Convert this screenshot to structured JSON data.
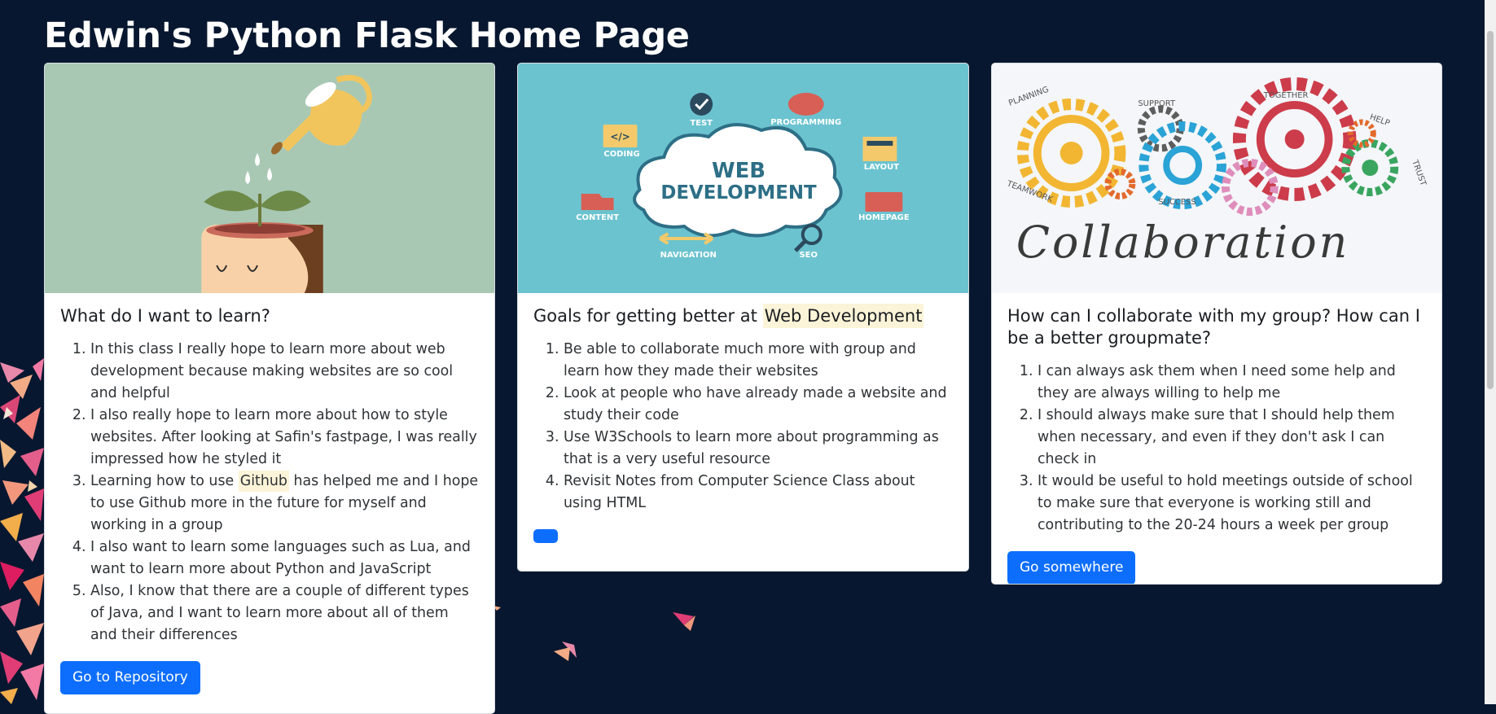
{
  "header": {
    "title": "Edwin's Python Flask Home Page"
  },
  "cards": [
    {
      "title": "What do I want to learn?",
      "items": [
        "In this class I really hope to learn more about web development because making websites are so cool and helpful",
        "I also really hope to learn more about how to style websites. After looking at Safin's fastpage, I was really impressed how he styled it",
        {
          "before": "Learning how to use ",
          "highlight": "Github",
          "after": " has helped me and I hope to use Github more in the future for myself and working in a group"
        },
        "I also want to learn some languages such as Lua, and want to learn more about Python and JavaScript",
        "Also, I know that there are a couple of different types of Java, and I want to learn more about all of them and their differences"
      ],
      "button": "Go to Repository"
    },
    {
      "title_prefix": "Goals for getting better at ",
      "title_highlight": "Web Development",
      "items": [
        "Be able to collaborate much more with group and learn how they made their websites",
        "Look at people who have already made a website and study their code",
        "Use W3Schools to learn more about programming as that is a very useful resource",
        "Revisit Notes from Computer Science Class about using HTML"
      ],
      "button": ""
    },
    {
      "title": "How can I collaborate with my group? How can I be a better groupmate?",
      "items": [
        "I can always ask them when I need some help and they are always willing to help me",
        "I should always make sure that I should help them when necessary, and even if they don't ask I can check in",
        "It would be useful to hold meetings outside of school to make sure that everyone is working still and contributing to the 20-24 hours a week per group"
      ],
      "button": "Go somewhere"
    }
  ],
  "images": {
    "web_dev": {
      "title_line1": "WEB",
      "title_line2": "DEVELOPMENT",
      "labels": [
        "TEST",
        "PROGRAMMING",
        "CODING",
        "LAYOUT",
        "CONTENT",
        "HOMEPAGE",
        "NAVIGATION",
        "SEO"
      ],
      "code_tag": "</>"
    },
    "collab": {
      "word": "Collaboration",
      "labels": [
        "PLANNING",
        "SUPPORT",
        "TOGETHER",
        "HELP",
        "TRUST",
        "TEAMWORK",
        "SUCCESS"
      ]
    }
  },
  "colors": {
    "background": "#07172f",
    "button": "#0d6efd",
    "highlight": "#fcf4d8"
  }
}
